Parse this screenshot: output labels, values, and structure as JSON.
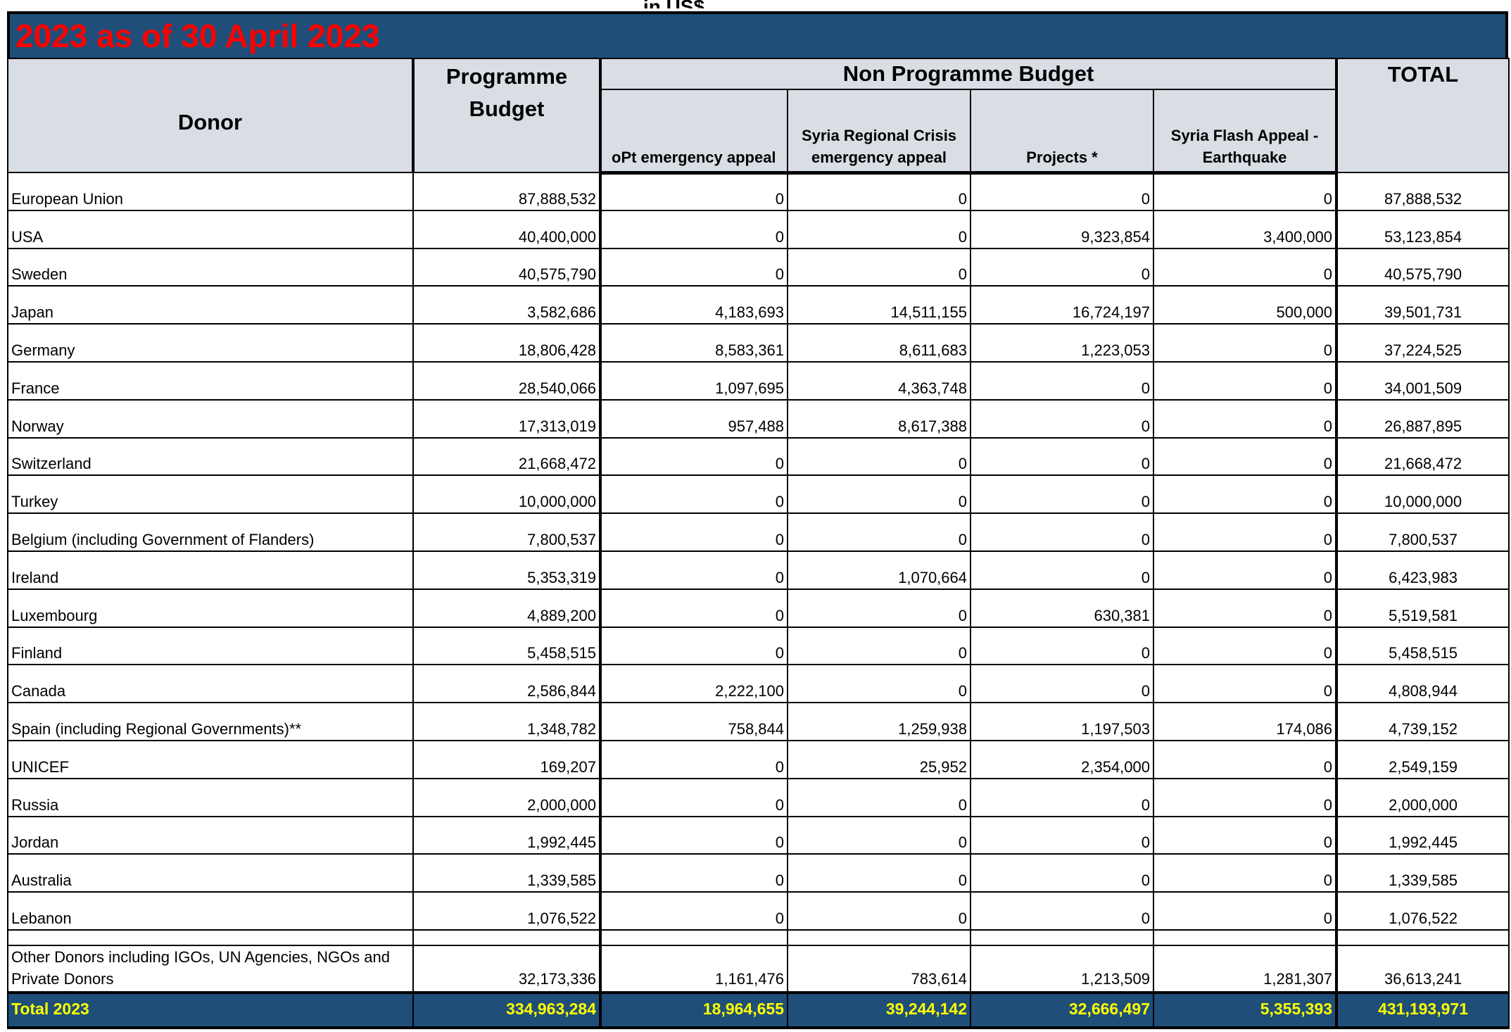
{
  "subtitle": "in US$",
  "banner_title": "2023 as of 30 April 2023",
  "headers": {
    "donor": "Donor",
    "programme_budget": "Programme Budget",
    "non_programme_budget": "Non Programme Budget",
    "total": "TOTAL",
    "opt": "oPt emergency appeal",
    "syria_regional": "Syria Regional Crisis emergency appeal",
    "projects": "Projects *",
    "syria_flash": "Syria Flash Appeal - Earthquake"
  },
  "rows": [
    {
      "donor": "European Union",
      "pb": "87,888,532",
      "opt": "0",
      "syria": "0",
      "projects": "0",
      "flash": "0",
      "total": "87,888,532"
    },
    {
      "donor": "USA",
      "pb": "40,400,000",
      "opt": "0",
      "syria": "0",
      "projects": "9,323,854",
      "flash": "3,400,000",
      "total": "53,123,854"
    },
    {
      "donor": "Sweden",
      "pb": "40,575,790",
      "opt": "0",
      "syria": "0",
      "projects": "0",
      "flash": "0",
      "total": "40,575,790"
    },
    {
      "donor": "Japan",
      "pb": "3,582,686",
      "opt": "4,183,693",
      "syria": "14,511,155",
      "projects": "16,724,197",
      "flash": "500,000",
      "total": "39,501,731"
    },
    {
      "donor": "Germany",
      "pb": "18,806,428",
      "opt": "8,583,361",
      "syria": "8,611,683",
      "projects": "1,223,053",
      "flash": "0",
      "total": "37,224,525"
    },
    {
      "donor": "France",
      "pb": "28,540,066",
      "opt": "1,097,695",
      "syria": "4,363,748",
      "projects": "0",
      "flash": "0",
      "total": "34,001,509"
    },
    {
      "donor": "Norway",
      "pb": "17,313,019",
      "opt": "957,488",
      "syria": "8,617,388",
      "projects": "0",
      "flash": "0",
      "total": "26,887,895"
    },
    {
      "donor": "Switzerland",
      "pb": "21,668,472",
      "opt": "0",
      "syria": "0",
      "projects": "0",
      "flash": "0",
      "total": "21,668,472"
    },
    {
      "donor": "Turkey",
      "pb": "10,000,000",
      "opt": "0",
      "syria": "0",
      "projects": "0",
      "flash": "0",
      "total": "10,000,000"
    },
    {
      "donor": "Belgium (including Government of Flanders)",
      "pb": "7,800,537",
      "opt": "0",
      "syria": "0",
      "projects": "0",
      "flash": "0",
      "total": "7,800,537"
    },
    {
      "donor": "Ireland",
      "pb": "5,353,319",
      "opt": "0",
      "syria": "1,070,664",
      "projects": "0",
      "flash": "0",
      "total": "6,423,983"
    },
    {
      "donor": "Luxembourg",
      "pb": "4,889,200",
      "opt": "0",
      "syria": "0",
      "projects": "630,381",
      "flash": "0",
      "total": "5,519,581"
    },
    {
      "donor": "Finland",
      "pb": "5,458,515",
      "opt": "0",
      "syria": "0",
      "projects": "0",
      "flash": "0",
      "total": "5,458,515"
    },
    {
      "donor": "Canada",
      "pb": "2,586,844",
      "opt": "2,222,100",
      "syria": "0",
      "projects": "0",
      "flash": "0",
      "total": "4,808,944"
    },
    {
      "donor": "Spain (including Regional Governments)**",
      "pb": "1,348,782",
      "opt": "758,844",
      "syria": "1,259,938",
      "projects": "1,197,503",
      "flash": "174,086",
      "total": "4,739,152"
    },
    {
      "donor": "UNICEF",
      "pb": "169,207",
      "opt": "0",
      "syria": "25,952",
      "projects": "2,354,000",
      "flash": "0",
      "total": "2,549,159"
    },
    {
      "donor": "Russia",
      "pb": "2,000,000",
      "opt": "0",
      "syria": "0",
      "projects": "0",
      "flash": "0",
      "total": "2,000,000"
    },
    {
      "donor": "Jordan",
      "pb": "1,992,445",
      "opt": "0",
      "syria": "0",
      "projects": "0",
      "flash": "0",
      "total": "1,992,445"
    },
    {
      "donor": "Australia",
      "pb": "1,339,585",
      "opt": "0",
      "syria": "0",
      "projects": "0",
      "flash": "0",
      "total": "1,339,585"
    },
    {
      "donor": "Lebanon",
      "pb": "1,076,522",
      "opt": "0",
      "syria": "0",
      "projects": "0",
      "flash": "0",
      "total": "1,076,522"
    }
  ],
  "other_row": {
    "donor": "Other Donors including IGOs, UN Agencies, NGOs and Private Donors",
    "pb": "32,173,336",
    "opt": "1,161,476",
    "syria": "783,614",
    "projects": "1,213,509",
    "flash": "1,281,307",
    "total": "36,613,241"
  },
  "total_row": {
    "label": "Total 2023",
    "pb": "334,963,284",
    "opt": "18,964,655",
    "syria": "39,244,142",
    "projects": "32,666,497",
    "flash": "5,355,393",
    "total": "431,193,971"
  },
  "colors": {
    "header_bg": "#d9dde4",
    "banner_bg": "#1f4e78",
    "banner_text": "#ff0000",
    "total_text": "#ffff00"
  }
}
